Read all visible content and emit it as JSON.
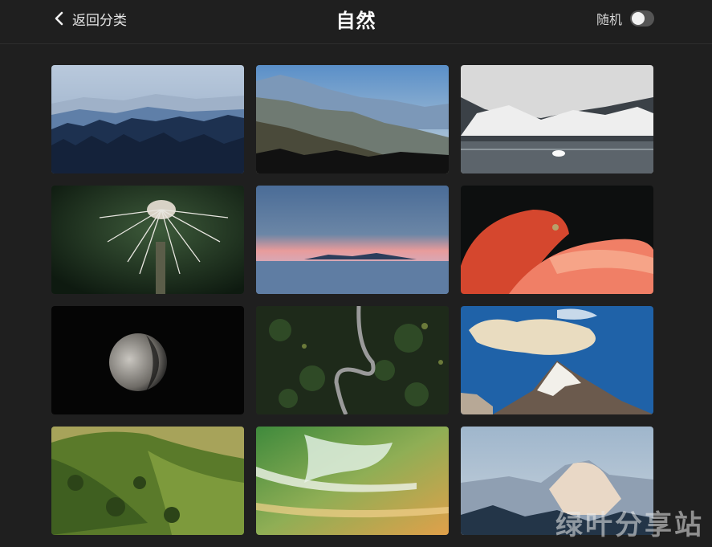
{
  "header": {
    "back_label": "返回分类",
    "title": "自然",
    "random_label": "随机",
    "random_enabled": false
  },
  "gallery": {
    "images": [
      {
        "name": "blue-mountain-forest"
      },
      {
        "name": "misty-mountain-valley"
      },
      {
        "name": "snowy-lake-swan"
      },
      {
        "name": "dandelion"
      },
      {
        "name": "sunset-sea-clouds"
      },
      {
        "name": "flamingo"
      },
      {
        "name": "moon"
      },
      {
        "name": "forest-winding-road"
      },
      {
        "name": "snowy-peak-blue-sky"
      },
      {
        "name": "green-hills"
      },
      {
        "name": "aerial-beach-waves"
      },
      {
        "name": "half-dome-snow"
      }
    ]
  },
  "watermark": "绿叶分享站",
  "colors": {
    "background": "#1f1f1f",
    "toggle_off": "#555555"
  }
}
